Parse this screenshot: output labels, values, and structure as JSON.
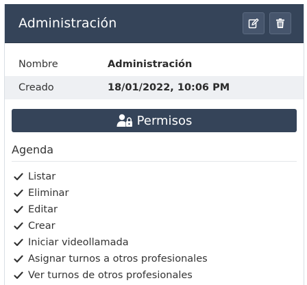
{
  "header": {
    "title": "Administración",
    "edit_icon": "edit-icon",
    "delete_icon": "trash-icon"
  },
  "info": [
    {
      "label": "Nombre",
      "value": "Administración"
    },
    {
      "label": "Creado",
      "value": "18/01/2022, 10:06 PM"
    }
  ],
  "permissions": {
    "icon": "user-lock-icon",
    "label": "Permisos",
    "section_title": "Agenda",
    "items": [
      "Listar",
      "Eliminar",
      "Editar",
      "Crear",
      "Iniciar videollamada",
      "Asignar turnos a otros profesionales",
      "Ver turnos de otros profesionales"
    ]
  },
  "colors": {
    "header_bg": "#354459",
    "stripe_bg": "#eef0f3"
  }
}
